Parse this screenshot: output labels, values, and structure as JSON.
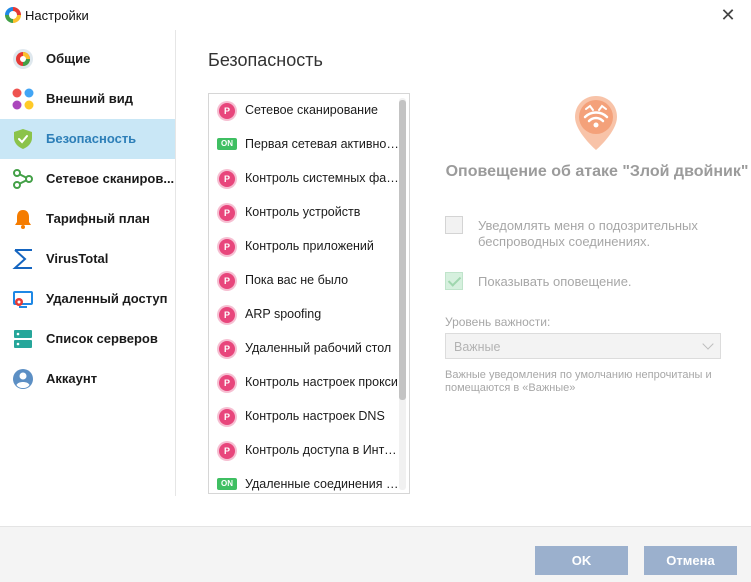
{
  "window": {
    "title": "Настройки"
  },
  "sidebar": {
    "items": [
      {
        "label": "Общие",
        "icon": "general-icon"
      },
      {
        "label": "Внешний вид",
        "icon": "appearance-icon"
      },
      {
        "label": "Безопасность",
        "icon": "shield-icon",
        "active": true
      },
      {
        "label": "Сетевое сканиров...",
        "icon": "network-scan-icon"
      },
      {
        "label": "Тарифный план",
        "icon": "bell-icon"
      },
      {
        "label": "VirusTotal",
        "icon": "virustotal-icon"
      },
      {
        "label": "Удаленный доступ",
        "icon": "remote-access-icon"
      },
      {
        "label": "Список серверов",
        "icon": "servers-icon"
      },
      {
        "label": "Аккаунт",
        "icon": "account-icon"
      }
    ]
  },
  "main": {
    "section_title": "Безопасность",
    "list": [
      {
        "label": "Сетевое сканирование",
        "badge": "P"
      },
      {
        "label": "Первая сетевая активность",
        "badge": "ON"
      },
      {
        "label": "Контроль системных файлов",
        "badge": "P"
      },
      {
        "label": "Контроль устройств",
        "badge": "P"
      },
      {
        "label": "Контроль приложений",
        "badge": "P"
      },
      {
        "label": "Пока вас не было",
        "badge": "P"
      },
      {
        "label": "ARP spoofing",
        "badge": "P"
      },
      {
        "label": "Удаленный рабочий стол",
        "badge": "P"
      },
      {
        "label": "Контроль настроек прокси",
        "badge": "P"
      },
      {
        "label": "Контроль настроек DNS",
        "badge": "P"
      },
      {
        "label": "Контроль доступа в Интернет",
        "badge": "P"
      },
      {
        "label": "Удаленные соединения G...",
        "badge": "ON"
      }
    ]
  },
  "detail": {
    "icon": "evil-twin-wifi-icon",
    "title": "Оповещение об атаке \"Злой двойник\"",
    "notify_label": "Уведомлять меня о подозрительных беспроводных соединениях.",
    "notify_checked": false,
    "show_label": "Показывать оповещение.",
    "show_checked": true,
    "importance_label": "Уровень важности:",
    "importance_value": "Важные",
    "hint": "Важные уведомления по умолчанию непрочитаны и помещаются в «Важные»"
  },
  "footer": {
    "ok_label": "OK",
    "cancel_label": "Отмена"
  },
  "colors": {
    "accent": "#c9e7f6",
    "button": "#9bb0cd",
    "badge_p": "#e8467c",
    "badge_on": "#3fbf62",
    "detail_icon": "#f4a17a"
  }
}
